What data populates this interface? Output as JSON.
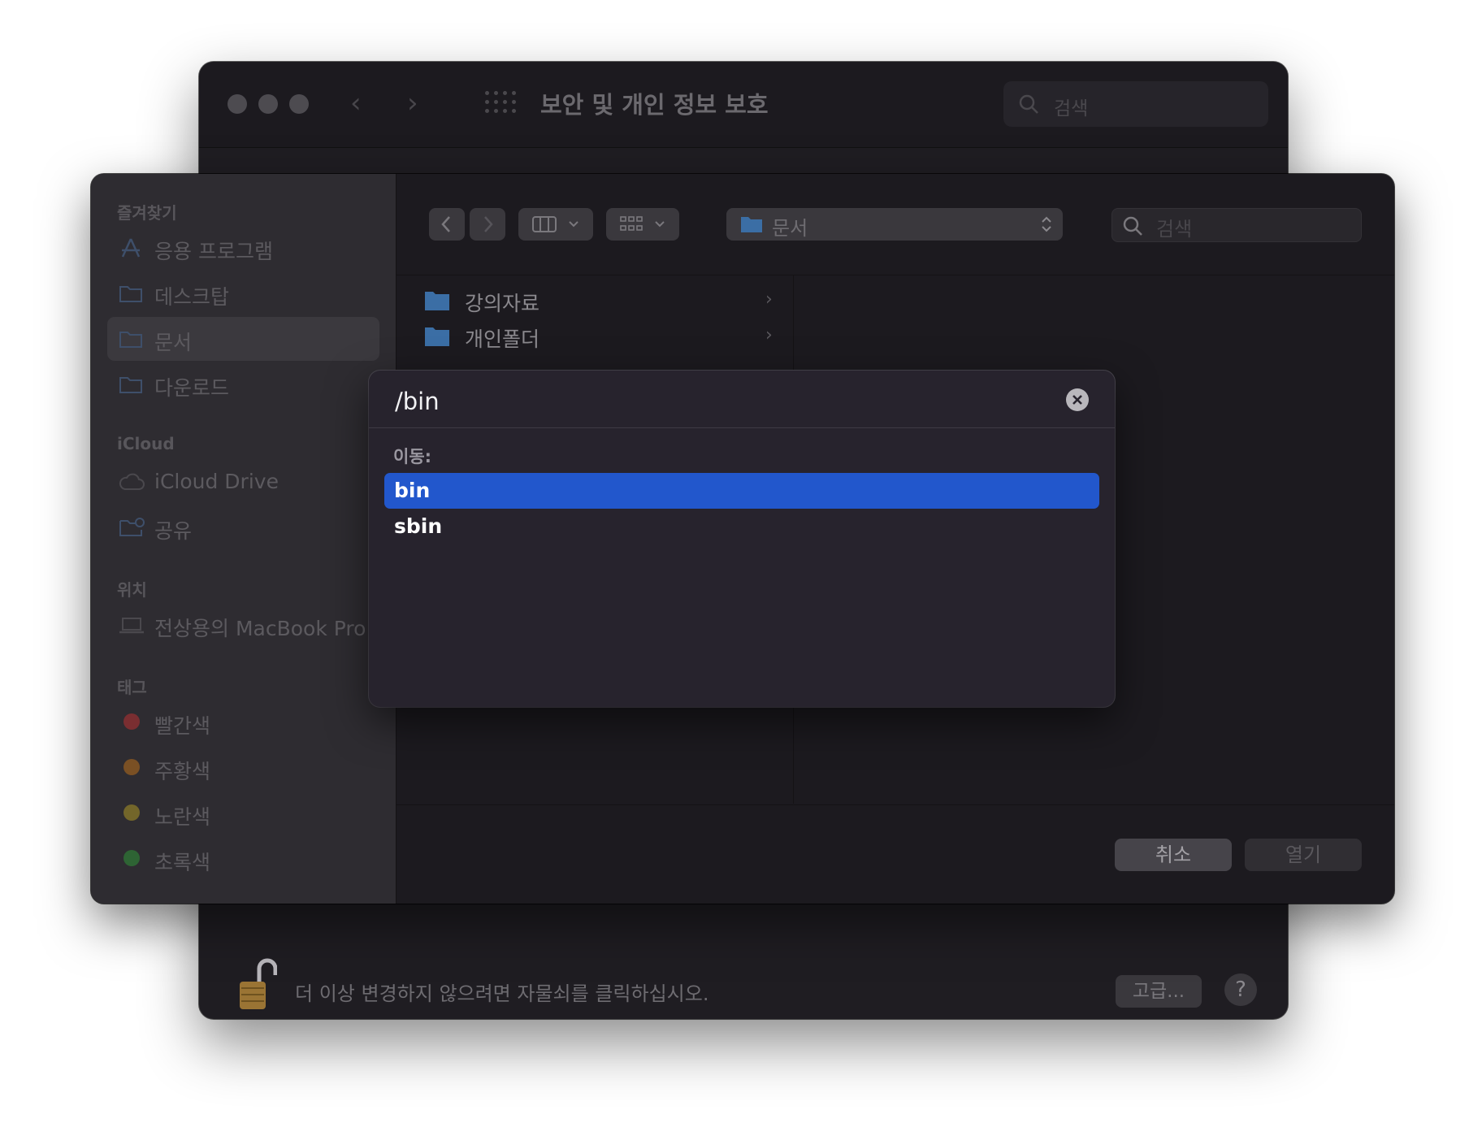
{
  "back_window": {
    "title": "보안 및 개인 정보 보호",
    "search_placeholder": "검색",
    "footer_text": "더 이상 변경하지 않으려면 자물쇠를 클릭하십시오.",
    "advanced_label": "고급...",
    "help_label": "?"
  },
  "sidebar": {
    "favorites_title": "즐겨찾기",
    "favorites": [
      {
        "label": "응용 프로그램",
        "icon": "applications-icon"
      },
      {
        "label": "데스크탑",
        "icon": "folder-icon"
      },
      {
        "label": "문서",
        "icon": "folder-icon",
        "selected": true
      },
      {
        "label": "다운로드",
        "icon": "folder-icon"
      }
    ],
    "icloud_title": "iCloud",
    "icloud": [
      {
        "label": "iCloud Drive",
        "icon": "cloud-icon"
      },
      {
        "label": "공유",
        "icon": "shared-folder-icon"
      }
    ],
    "locations_title": "위치",
    "locations": [
      {
        "label": "전상용의 MacBook Pro",
        "icon": "laptop-icon"
      }
    ],
    "tags_title": "태그",
    "tags": [
      {
        "label": "빨간색",
        "color": "#7a2e31"
      },
      {
        "label": "주황색",
        "color": "#7a5024"
      },
      {
        "label": "노란색",
        "color": "#73662a"
      },
      {
        "label": "초록색",
        "color": "#2e6434"
      }
    ]
  },
  "toolbar": {
    "path_label": "문서",
    "search_placeholder": "검색"
  },
  "files": [
    {
      "name": "강의자료"
    },
    {
      "name": "개인폴더"
    }
  ],
  "buttons": {
    "cancel": "취소",
    "open": "열기"
  },
  "goto": {
    "input_value": "/bin",
    "section_label": "이동:",
    "results": [
      {
        "label": "bin",
        "selected": true
      },
      {
        "label": "sbin",
        "selected": false
      }
    ]
  },
  "colors": {
    "accent": "#2257cc"
  }
}
